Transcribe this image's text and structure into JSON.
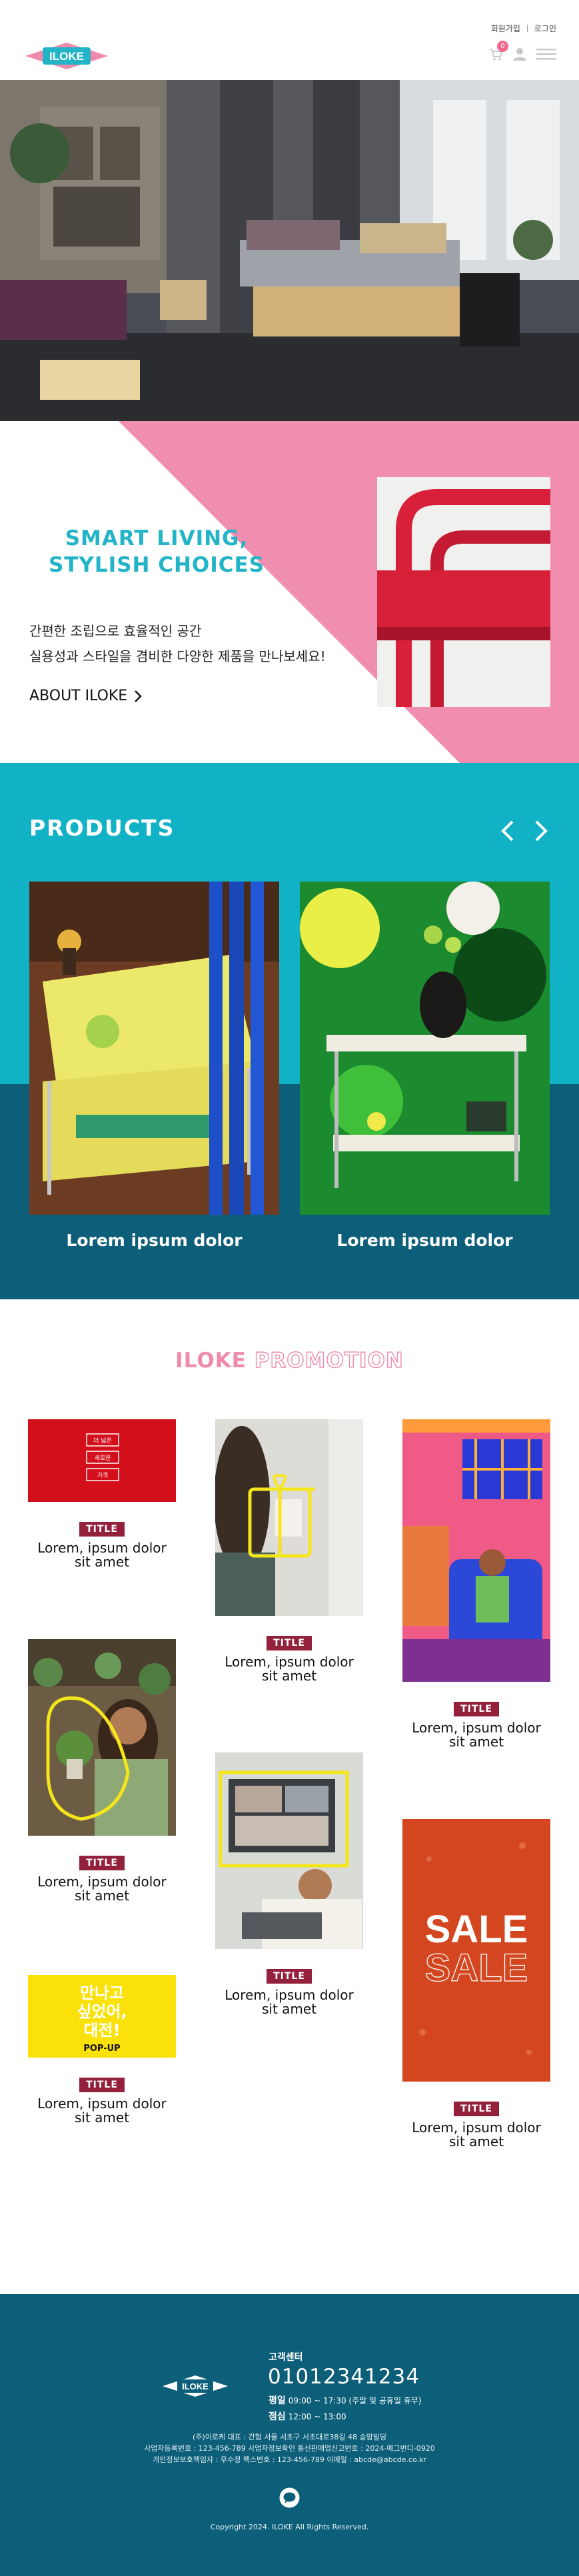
{
  "header": {
    "logo_text": "ILOKE",
    "top_links": [
      "회원가입",
      "로그인"
    ],
    "cart_count": "0"
  },
  "intro": {
    "title_lines": [
      "SMART LIVING,",
      "STYLISH CHOICES"
    ],
    "desc_lines": [
      "간편한 조립으로 효율적인 공간",
      "실용성과 스타일을 겸비한 다양한 제품을 만나보세요!"
    ],
    "about_label": "ABOUT ILOKE"
  },
  "products": {
    "title": "PRODUCTS",
    "items": [
      {
        "name": "Lorem ipsum dolor"
      },
      {
        "name": "Lorem ipsum dolor"
      }
    ]
  },
  "promotion": {
    "title_part1": "ILOKE",
    "title_part2": "PROMOTION",
    "items": [
      {
        "tag": "TITLE",
        "lines": [
          "Lorem, ipsum dolor",
          "sit amet"
        ],
        "buttons": [
          "더 넓은",
          "새로운",
          "가격"
        ]
      },
      {
        "tag": "TITLE",
        "lines": [
          "Lorem, ipsum dolor",
          "sit amet"
        ]
      },
      {
        "tag": "TITLE",
        "lines": [
          "Lorem, ipsum dolor",
          "sit amet"
        ]
      },
      {
        "tag": "TITLE",
        "lines": [
          "Lorem, ipsum dolor",
          "sit amet"
        ]
      },
      {
        "tag": "TITLE",
        "lines": [
          "Lorem, ipsum dolor",
          "sit amet"
        ]
      },
      {
        "tag": "TITLE",
        "lines": [
          "Lorem, ipsum dolor",
          "sit amet"
        ],
        "sale": "SALE"
      },
      {
        "tag": "TITLE",
        "lines": [
          "Lorem, ipsum dolor",
          "sit amet"
        ],
        "popup_lines": [
          "만나고",
          "싶었어,",
          "대전!"
        ],
        "popup_label": "POP-UP"
      }
    ]
  },
  "footer": {
    "logo_text": "ILOKE",
    "cs_label": "고객센터",
    "phone": "01012341234",
    "hours": [
      {
        "label": "평일",
        "value": "09:00 ~ 17:30 (주말 및 공휴일 휴무)"
      },
      {
        "label": "점심",
        "value": "12:00 ~ 13:00"
      }
    ],
    "info_lines": [
      "(주)이로케   대표 : 간험   서울 서초구 서초대로38길 48 송암빌딩",
      "사업자등록번호 : 123-456-789 사업자정보확인   통신판매업신고번호 : 2024-예그번디-0920",
      "개인정보보호책임자 : 우수정   팩스번호 : 123-456-789   이메일 : abcde@abcde.co.kr"
    ],
    "copyright": "Copyright 2024. ILOKE All Rights Reserved.",
    "talk_icon": "chat-bubble-icon"
  },
  "colors": {
    "accent_cyan": "#12b2c6",
    "accent_pink": "#ef8aaa",
    "dark_teal": "#0d5f79",
    "tag_red": "#94213c"
  }
}
